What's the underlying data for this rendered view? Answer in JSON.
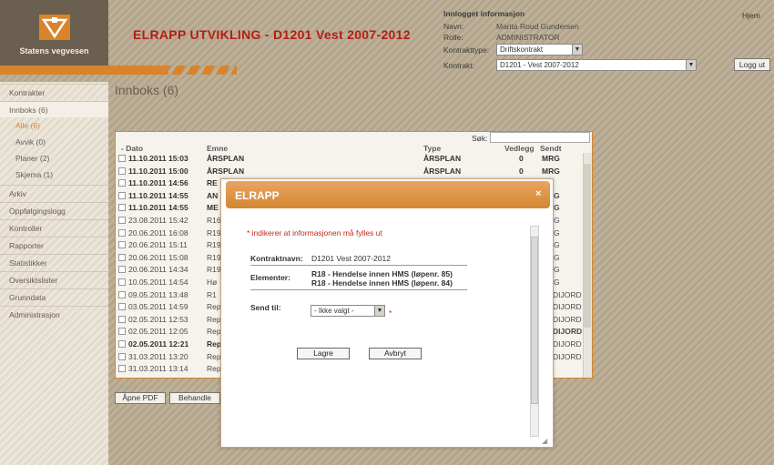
{
  "header": {
    "logo_text": "Statens vegvesen",
    "app_title": "ELRAPP UTVIKLING - D1201 Vest 2007-2012",
    "home_link": "Hjem",
    "info_heading": "Innlogget informasjon",
    "name_label": "Navn:",
    "name_value": "Marita Roud Gundersen",
    "role_label": "Rolle:",
    "role_value": "ADMINISTRATOR",
    "contract_type_label": "Kontrakttype:",
    "contract_type_value": "Driftskontrakt",
    "contract_label": "Kontrakt:",
    "contract_value": "D1201 - Vest 2007-2012",
    "logout_label": "Logg ut"
  },
  "sidebar": {
    "items": [
      {
        "label": "Kontrakter"
      },
      {
        "label": "Innboks (6)"
      },
      {
        "label": "Arkiv"
      },
      {
        "label": "Oppfølgingslogg"
      },
      {
        "label": "Kontroller"
      },
      {
        "label": "Rapporter"
      },
      {
        "label": "Statistikker"
      },
      {
        "label": "Oversiktslister"
      },
      {
        "label": "Grunndata"
      },
      {
        "label": "Administrasjon"
      }
    ],
    "sub_items": [
      {
        "label": "Alle (6)"
      },
      {
        "label": "Avvik (0)"
      },
      {
        "label": "Planer (2)"
      },
      {
        "label": "Skjema (1)"
      }
    ]
  },
  "main": {
    "page_title": "Innboks (6)",
    "search_label": "Søk:",
    "columns": {
      "date": "- Dato",
      "subject": "Emne",
      "type": "Type",
      "attachment": "Vedlegg",
      "sent": "Sendt"
    },
    "rows": [
      {
        "date": "11.10.2011 15:03",
        "subject": "ÅRSPLAN",
        "type": "ÅRSPLAN",
        "att": "0",
        "sent": "MRG",
        "bold": true
      },
      {
        "date": "11.10.2011 15:00",
        "subject": "ÅRSPLAN",
        "type": "ÅRSPLAN",
        "att": "0",
        "sent": "MRG",
        "bold": true
      },
      {
        "date": "11.10.2011 14:56",
        "subject": "RE",
        "type": "",
        "att": "",
        "sent": "",
        "bold": true
      },
      {
        "date": "11.10.2011 14:55",
        "subject": "AN",
        "type": "",
        "att": "",
        "sent": "",
        "bold": true
      },
      {
        "date": "11.10.2011 14:55",
        "subject": "ME",
        "type": "",
        "att": "",
        "sent": "",
        "bold": true
      },
      {
        "date": "23.08.2011 15:42",
        "subject": "R16",
        "type": "",
        "att": "",
        "sent": "",
        "bold": false
      },
      {
        "date": "20.06.2011 16:08",
        "subject": "R19",
        "type": "",
        "att": "",
        "sent": "",
        "bold": false
      },
      {
        "date": "20.06.2011 15:11",
        "subject": "R19",
        "type": "",
        "att": "",
        "sent": "",
        "bold": false
      },
      {
        "date": "20.06.2011 15:08",
        "subject": "R19",
        "type": "",
        "att": "",
        "sent": "",
        "bold": false
      },
      {
        "date": "20.06.2011 14:34",
        "subject": "R19",
        "type": "",
        "att": "",
        "sent": "",
        "bold": false
      },
      {
        "date": "10.05.2011 14:54",
        "subject": "Hø",
        "type": "",
        "att": "",
        "sent": "",
        "bold": false
      },
      {
        "date": "09.05.2011 13:48",
        "subject": "R1",
        "type": "",
        "att": "",
        "sent": "",
        "bold": false
      },
      {
        "date": "03.05.2011 14:59",
        "subject": "Rep",
        "type": "",
        "att": "",
        "sent": "",
        "bold": false
      },
      {
        "date": "02.05.2011 12:53",
        "subject": "Rep",
        "type": "",
        "att": "",
        "sent": "",
        "bold": false
      },
      {
        "date": "02.05.2011 12:05",
        "subject": "Rep",
        "type": "",
        "att": "",
        "sent": "",
        "bold": false
      },
      {
        "date": "02.05.2011 12:21",
        "subject": "Rep",
        "type": "",
        "att": "",
        "sent": "",
        "bold": true
      },
      {
        "date": "31.03.2011 13:20",
        "subject": "Rep",
        "type": "",
        "att": "",
        "sent": "",
        "bold": false
      },
      {
        "date": "31.03.2011 13:14",
        "subject": "Rep",
        "type": "",
        "att": "",
        "sent": "",
        "bold": false
      }
    ],
    "right_partials": [
      "G",
      "G",
      "G",
      "G",
      "G",
      "G",
      "G",
      "G",
      "DIJORD",
      "DIJORD",
      "DIJORD",
      "DIJORD",
      "DIJORD",
      "DIJORD"
    ],
    "btn_open_pdf": "Åpne PDF",
    "btn_process": "Behandle"
  },
  "modal": {
    "title": "ELRAPP",
    "close": "×",
    "required_note": "* indikerer at informasjonen må fylles ut",
    "contract_name_label": "Kontraktnavn:",
    "contract_name_value": "D1201 Vest 2007-2012",
    "elements_label": "Elementer:",
    "elements": [
      "R18 - Hendelse innen HMS (løpenr. 85)",
      "R18 - Hendelse innen HMS (løpenr. 84)"
    ],
    "send_to_label": "Send til:",
    "send_to_value": "- Ikke valgt -",
    "required_star": "*",
    "save_label": "Lagre",
    "cancel_label": "Avbryt"
  },
  "colors": {
    "accent_orange": "#d9832b",
    "title_red": "#b51d14",
    "required_red": "#c0261b"
  }
}
